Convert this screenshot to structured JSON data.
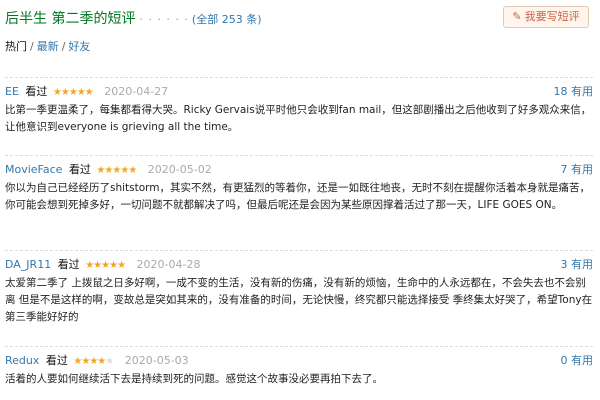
{
  "header": {
    "title": "后半生 第二季的短评",
    "dots": "· · · · · ·",
    "total": "(全部 253 条)",
    "write_button": "我要写短评",
    "write_icon": "pencil-icon"
  },
  "sortbar": {
    "hot": "热门",
    "latest": "最新",
    "friends": "好友",
    "separator": "/"
  },
  "reviews": [
    {
      "user": "EE",
      "watched": "看过",
      "rating": 5,
      "date": "2020-04-27",
      "useful": "18 有用",
      "text": "比第一季更温柔了，每集都看得大哭。Ricky Gervais说平时他只会收到fan mail，但这部剧播出之后他收到了好多观众来信，让他意识到everyone is grieving all the time。"
    },
    {
      "user": "MovieFace",
      "watched": "看过",
      "rating": 5,
      "date": "2020-05-02",
      "useful": "7 有用",
      "text": "你以为自己已经经历了shitstorm，其实不然，有更猛烈的等着你，还是一如既往地丧，无时不刻在提醒你活着本身就是痛苦，你可能会想到死掉多好，一切问题不就都解决了吗，但最后呢还是会因为某些原因撑着活过了那一天，LIFE GOES ON。"
    },
    {
      "user": "DA_JR11",
      "watched": "看过",
      "rating": 5,
      "date": "2020-04-28",
      "useful": "3 有用",
      "text": "太爱第二季了 上拨鼠之日多好啊，一成不变的生活，没有新的伤痛，没有新的烦恼，生命中的人永远都在，不会失去也不会别离 但是不是这样的啊，变故总是突如其来的，没有准备的时间，无论快慢，终究都只能选择接受 季终集太好哭了，希望Tony在第三季能好好的"
    },
    {
      "user": "Redux",
      "watched": "看过",
      "rating": 4,
      "date": "2020-05-03",
      "useful": "0 有用",
      "text": "活着的人要如何继续活下去是持续到死的问题。感觉这个故事没必要再拍下去了。"
    }
  ]
}
